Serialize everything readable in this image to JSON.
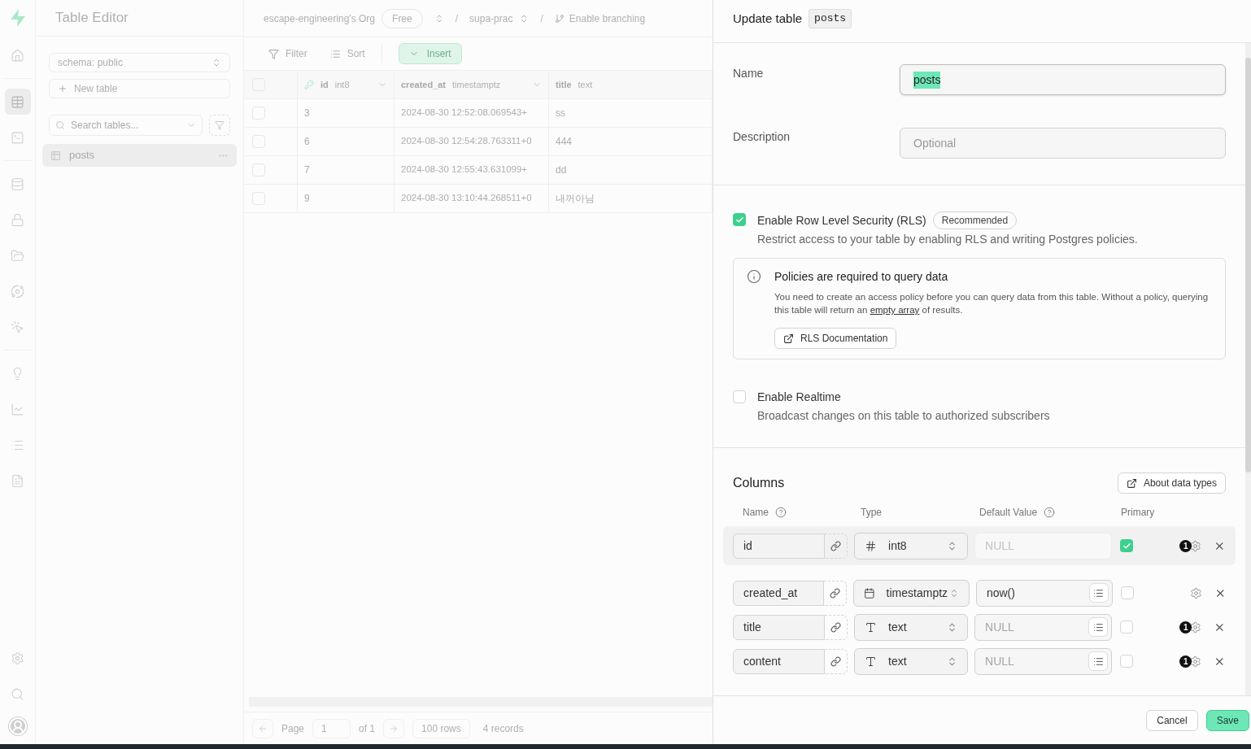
{
  "rail": [
    {
      "kind": "home",
      "selected": false
    },
    {
      "kind": "table",
      "selected": true
    },
    {
      "kind": "terminal",
      "selected": false
    },
    {
      "kind": "database",
      "selected": false
    },
    {
      "kind": "lock",
      "selected": false
    },
    {
      "kind": "storage",
      "selected": false
    },
    {
      "kind": "functions",
      "selected": false
    },
    {
      "kind": "realtime",
      "selected": false
    },
    {
      "kind": "advisor",
      "selected": false
    },
    {
      "kind": "reports",
      "selected": false
    },
    {
      "kind": "logs",
      "selected": false
    },
    {
      "kind": "docs",
      "selected": false
    }
  ],
  "rail_bottom": [
    {
      "kind": "settings",
      "selected": false
    },
    {
      "kind": "search",
      "selected": false
    }
  ],
  "app": {
    "title": "Table Editor"
  },
  "breadcrumb": {
    "org": "escape-engineering's Org",
    "plan": "Free",
    "project": "supa-prac",
    "branching": "Enable branching",
    "separators": [
      "/",
      "/"
    ]
  },
  "sidebar": {
    "schema": "schema: public",
    "new_table": "New table",
    "search_placeholder": "Search tables...",
    "tables": [
      {
        "name": "posts",
        "selected": true
      }
    ]
  },
  "toolbar": {
    "filter": "Filter",
    "sort": "Sort",
    "insert": "Insert"
  },
  "grid": {
    "all_checked": false,
    "columns": [
      {
        "name": "id",
        "type": "int8",
        "kind": "key"
      },
      {
        "name": "created_at",
        "type": "timestamptz",
        "kind": "plain"
      },
      {
        "name": "title",
        "type": "text",
        "kind": "plain"
      }
    ],
    "rows": [
      {
        "checked": false,
        "cells": [
          "3",
          "2024-08-30 12:52:08.069543+",
          "ss"
        ]
      },
      {
        "checked": false,
        "cells": [
          "6",
          "2024-08-30 12:54:28.763311+0",
          "444"
        ]
      },
      {
        "checked": false,
        "cells": [
          "7",
          "2024-08-30 12:55:43.631099+",
          "dd"
        ]
      },
      {
        "checked": false,
        "cells": [
          "9",
          "2024-08-30 13:10:44.268511+0",
          "내꺼아님"
        ]
      }
    ]
  },
  "pagination": {
    "page_label": "Page",
    "page": "1",
    "of": "of 1",
    "rows": "100 rows",
    "records": "4 records"
  },
  "panel": {
    "title": "Update table",
    "table_name": "posts",
    "name": {
      "label": "Name",
      "value": "posts",
      "text_selected": true
    },
    "description": {
      "label": "Description",
      "placeholder": "Optional"
    },
    "rls": {
      "checked": true,
      "label": "Enable Row Level Security (RLS)",
      "badge": "Recommended",
      "description": "Restrict access to your table by enabling RLS and writing Postgres policies."
    },
    "notice": {
      "title": "Policies are required to query data",
      "text_before": "You need to create an access policy before you can query data from this table. Without a policy, querying this table will return an ",
      "link": "empty array",
      "text_after": " of results.",
      "button": "RLS Documentation"
    },
    "realtime": {
      "checked": false,
      "label": "Enable Realtime",
      "description": "Broadcast changes on this table to authorized subscribers"
    },
    "columns": {
      "title": "Columns",
      "about": "About data types",
      "headers": [
        {
          "label": "Name",
          "help": true
        },
        {
          "label": "Type",
          "help": false
        },
        {
          "label": "Default Value",
          "help": true
        },
        {
          "label": "Primary",
          "help": false
        }
      ],
      "rows": [
        {
          "name": "id",
          "type": "int8",
          "kind": "number",
          "default_placeholder": "NULL",
          "default_editable": false,
          "primary": true,
          "badge": "1",
          "highlighted": true
        },
        {
          "name": "created_at",
          "type": "timestamptz",
          "kind": "date",
          "default_value": "now()",
          "default_editable": true,
          "primary": false,
          "highlighted": false
        },
        {
          "name": "title",
          "type": "text",
          "kind": "text",
          "default_placeholder": "NULL",
          "default_editable": true,
          "primary": false,
          "badge": "1",
          "highlighted": false
        },
        {
          "name": "content",
          "type": "text",
          "kind": "text",
          "default_placeholder": "NULL",
          "default_editable": true,
          "primary": false,
          "badge": "1",
          "highlighted": false
        }
      ]
    },
    "footer": {
      "cancel": "Cancel",
      "save": "Save"
    }
  }
}
